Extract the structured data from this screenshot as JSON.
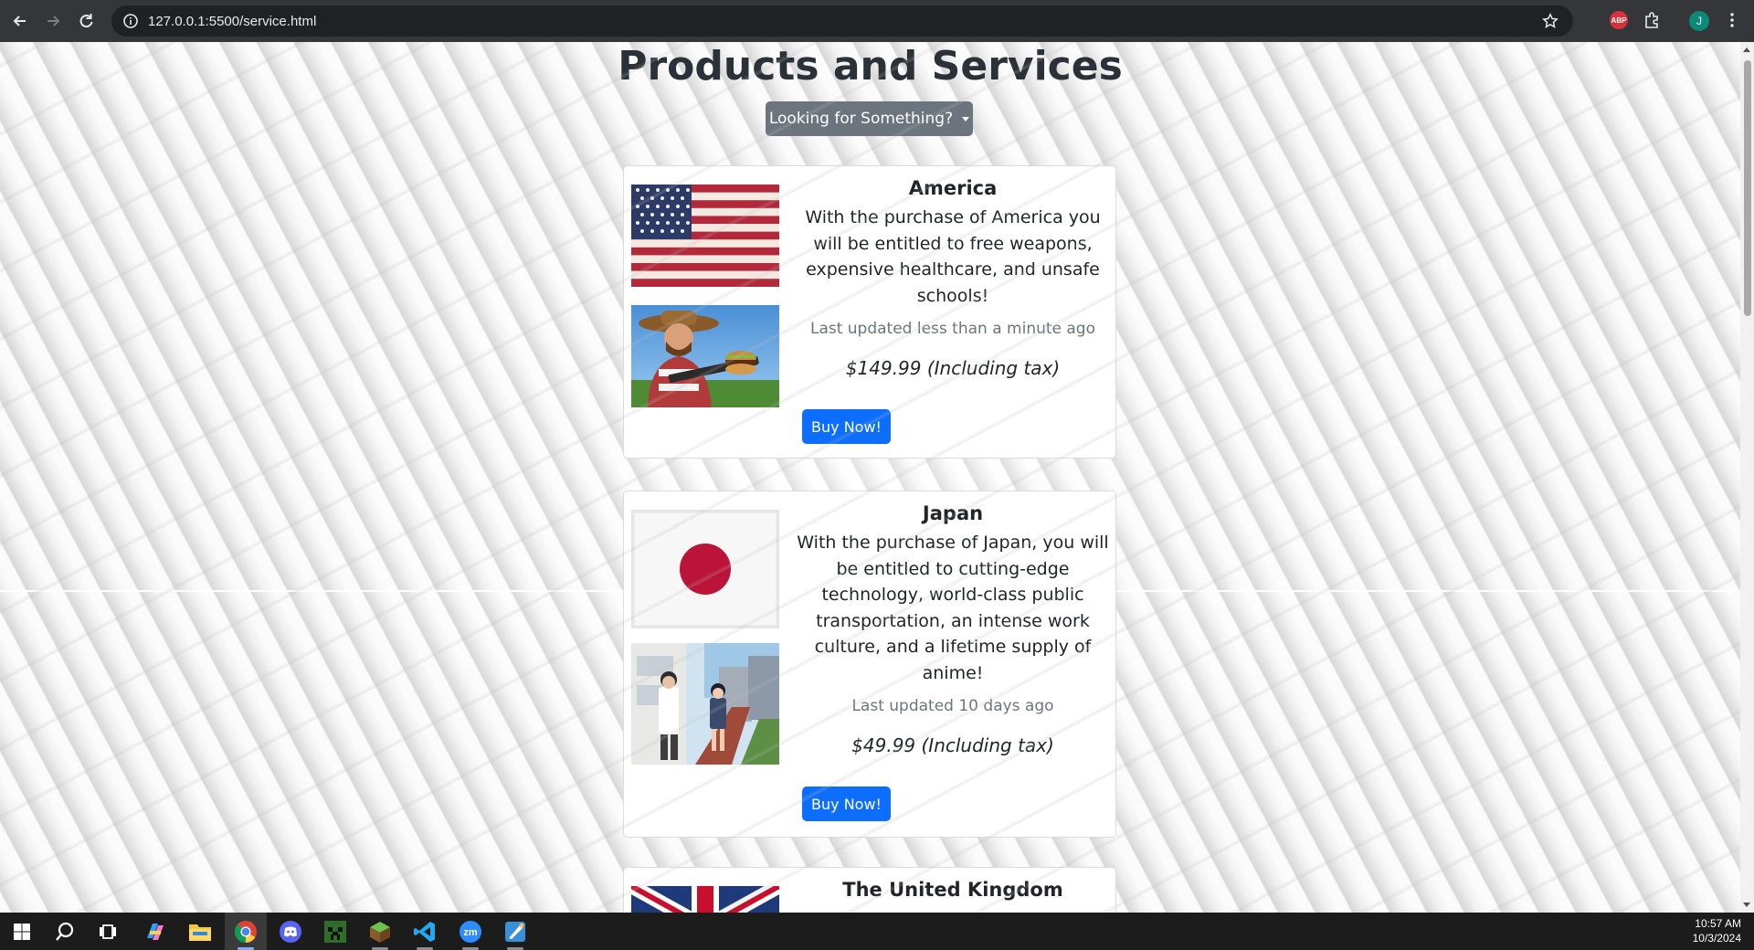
{
  "browser": {
    "url": "127.0.0.1:5500/service.html",
    "profile_initial": "J",
    "abp_label": "ABP",
    "icons": [
      "back-icon",
      "forward-icon",
      "reload-icon",
      "site-info-icon",
      "bookmark-star-icon",
      "extensions-icon",
      "menu-icon"
    ]
  },
  "page": {
    "title": "Products and Services",
    "dropdown_label": "Looking for Something?",
    "colors": {
      "dropdown": "#6c757d",
      "buy_button": "#0d6efd",
      "title": "#2b3138"
    }
  },
  "products": [
    {
      "title": "America",
      "description": "With the purchase of America you will be entitled to free weapons, expensive healthcare, and unsafe schools!",
      "updated": "Last updated less than a minute ago",
      "price": "$149.99 (Including tax)",
      "button": "Buy Now!",
      "images": [
        "us-flag-image",
        "cowboy-burger-image"
      ]
    },
    {
      "title": "Japan",
      "description": "With the purchase of Japan, you will be entitled to cutting-edge technology, world-class public transportation, an intense work culture, and a lifetime supply of anime!",
      "updated": "Last updated 10 days ago",
      "price": "$49.99 (Including tax)",
      "button": "Buy Now!",
      "images": [
        "japan-flag-image",
        "anime-street-image"
      ]
    },
    {
      "title": "The United Kingdom",
      "images": [
        "uk-flag-image"
      ]
    }
  ],
  "taskbar": {
    "time": "10:57 AM",
    "date": "10/3/2024",
    "apps": [
      "windows-start-icon",
      "search-icon",
      "task-view-icon",
      "copilot-icon",
      "file-explorer-icon",
      "chrome-icon",
      "discord-icon",
      "minecraft-icon",
      "minecraft-launcher-icon",
      "vscode-icon",
      "zoom-icon",
      "paint-icon"
    ]
  }
}
